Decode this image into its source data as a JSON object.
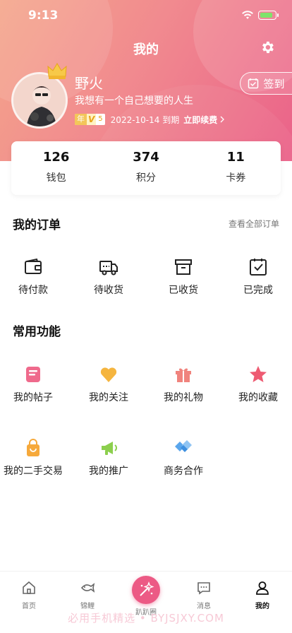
{
  "status": {
    "time": "9:13"
  },
  "header": {
    "title": "我的"
  },
  "profile": {
    "nickname": "野火",
    "bio": "我想有一个自己想要的人生",
    "vip_year": "年",
    "vip_letter": "V",
    "vip_level": "5",
    "expire": "2022-10-14 到期",
    "renew": "立即续费",
    "checkin": "签到"
  },
  "stats": [
    {
      "value": "126",
      "label": "钱包"
    },
    {
      "value": "374",
      "label": "积分"
    },
    {
      "value": "11",
      "label": "卡券"
    }
  ],
  "orders": {
    "title": "我的订单",
    "view_all": "查看全部订单",
    "items": [
      {
        "label": "待付款",
        "icon": "wallet-icon"
      },
      {
        "label": "待收货",
        "icon": "truck-icon"
      },
      {
        "label": "已收货",
        "icon": "archive-box-icon"
      },
      {
        "label": "已完成",
        "icon": "check-square-icon"
      }
    ]
  },
  "functions": {
    "title": "常用功能",
    "items": [
      {
        "label": "我的帖子",
        "icon": "post-icon",
        "color": "#ef6a8c"
      },
      {
        "label": "我的关注",
        "icon": "heart-icon",
        "color": "#f5b53f"
      },
      {
        "label": "我的礼物",
        "icon": "gift-icon",
        "color": "#f0837d"
      },
      {
        "label": "我的收藏",
        "icon": "star-icon",
        "color": "#ee5b72"
      },
      {
        "label": "我的二手交易",
        "icon": "bag-icon",
        "color": "#f6a93b"
      },
      {
        "label": "我的推广",
        "icon": "megaphone-icon",
        "color": "#8ccf4d"
      },
      {
        "label": "商务合作",
        "icon": "handshake-icon",
        "color": "#5aa6ec"
      }
    ]
  },
  "tabbar": [
    {
      "label": "首页",
      "icon": "home-icon"
    },
    {
      "label": "锦鲤",
      "icon": "koi-icon"
    },
    {
      "label": "趴趴圈",
      "icon": "magic-icon"
    },
    {
      "label": "消息",
      "icon": "message-icon"
    },
    {
      "label": "我的",
      "icon": "user-icon"
    }
  ],
  "watermark": "必用手机精选 • BYJSJXY.COM"
}
